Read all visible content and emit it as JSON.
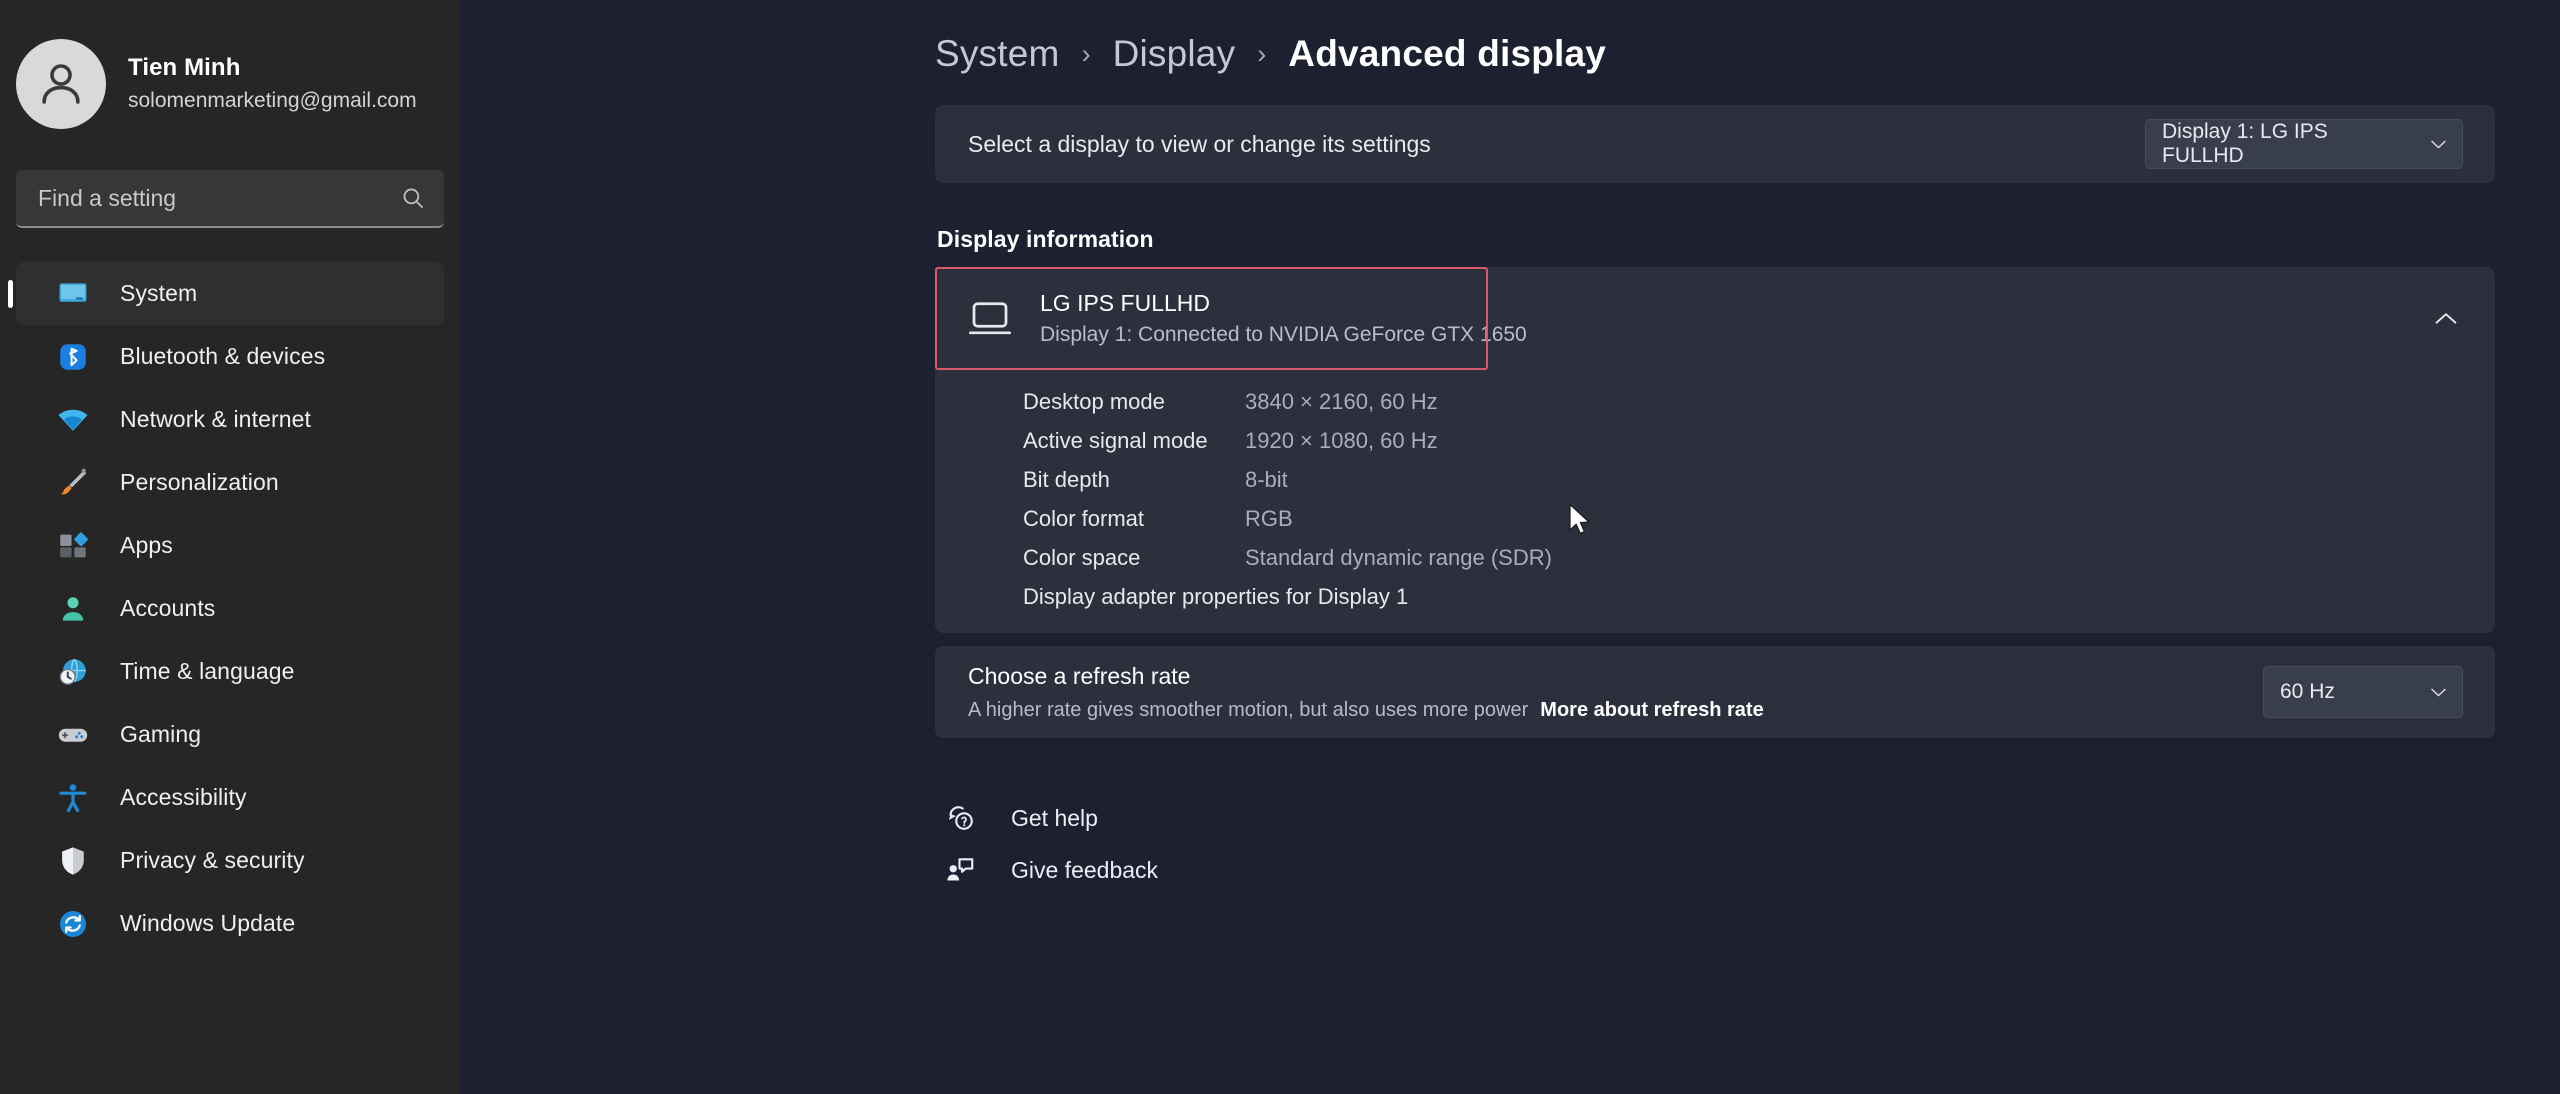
{
  "sidebar": {
    "account": {
      "name": "Tien Minh",
      "email": "solomenmarketing@gmail.com",
      "avatar_icon": "person-icon"
    },
    "search": {
      "placeholder": "Find a setting",
      "value": "",
      "icon": "search-icon"
    },
    "items": [
      {
        "label": "System",
        "icon": "monitor-icon",
        "selected": true
      },
      {
        "label": "Bluetooth & devices",
        "icon": "bluetooth-icon",
        "selected": false
      },
      {
        "label": "Network & internet",
        "icon": "wifi-icon",
        "selected": false
      },
      {
        "label": "Personalization",
        "icon": "paintbrush-icon",
        "selected": false
      },
      {
        "label": "Apps",
        "icon": "apps-icon",
        "selected": false
      },
      {
        "label": "Accounts",
        "icon": "account-icon",
        "selected": false
      },
      {
        "label": "Time & language",
        "icon": "clock-globe-icon",
        "selected": false
      },
      {
        "label": "Gaming",
        "icon": "gamepad-icon",
        "selected": false
      },
      {
        "label": "Accessibility",
        "icon": "accessibility-icon",
        "selected": false
      },
      {
        "label": "Privacy & security",
        "icon": "shield-icon",
        "selected": false
      },
      {
        "label": "Windows Update",
        "icon": "update-icon",
        "selected": false
      }
    ]
  },
  "breadcrumb": {
    "root": "System",
    "parent": "Display",
    "current": "Advanced display",
    "separator": "›"
  },
  "select_display": {
    "label": "Select a display to view or change its settings",
    "dropdown_value": "Display 1: LG IPS FULLHD",
    "dropdown_icon": "chevron-down-icon"
  },
  "display_information": {
    "section_title": "Display information",
    "monitor_icon": "monitor-icon",
    "title": "LG IPS FULLHD",
    "subtitle": "Display 1: Connected to NVIDIA GeForce GTX 1650",
    "collapse_icon": "chevron-up-icon",
    "expanded": true,
    "highlight_color": "#d9596a",
    "details": [
      {
        "key": "Desktop mode",
        "value": "3840 × 2160, 60 Hz"
      },
      {
        "key": "Active signal mode",
        "value": "1920 × 1080, 60 Hz"
      },
      {
        "key": "Bit depth",
        "value": "8-bit"
      },
      {
        "key": "Color format",
        "value": "RGB"
      },
      {
        "key": "Color space",
        "value": "Standard dynamic range (SDR)"
      }
    ],
    "adapter_link": "Display adapter properties for Display 1"
  },
  "refresh_rate": {
    "title": "Choose a refresh rate",
    "description": "A higher rate gives smoother motion, but also uses more power",
    "link": "More about refresh rate",
    "dropdown_value": "60 Hz",
    "dropdown_icon": "chevron-down-icon"
  },
  "footer": {
    "links": [
      {
        "label": "Get help",
        "icon": "help-icon"
      },
      {
        "label": "Give feedback",
        "icon": "feedback-icon"
      }
    ]
  },
  "theme": {
    "page_bg": "#1c2030",
    "card_bg": "#2c303c",
    "sidebar_bg": "#262626",
    "accent": "#ffffff"
  }
}
